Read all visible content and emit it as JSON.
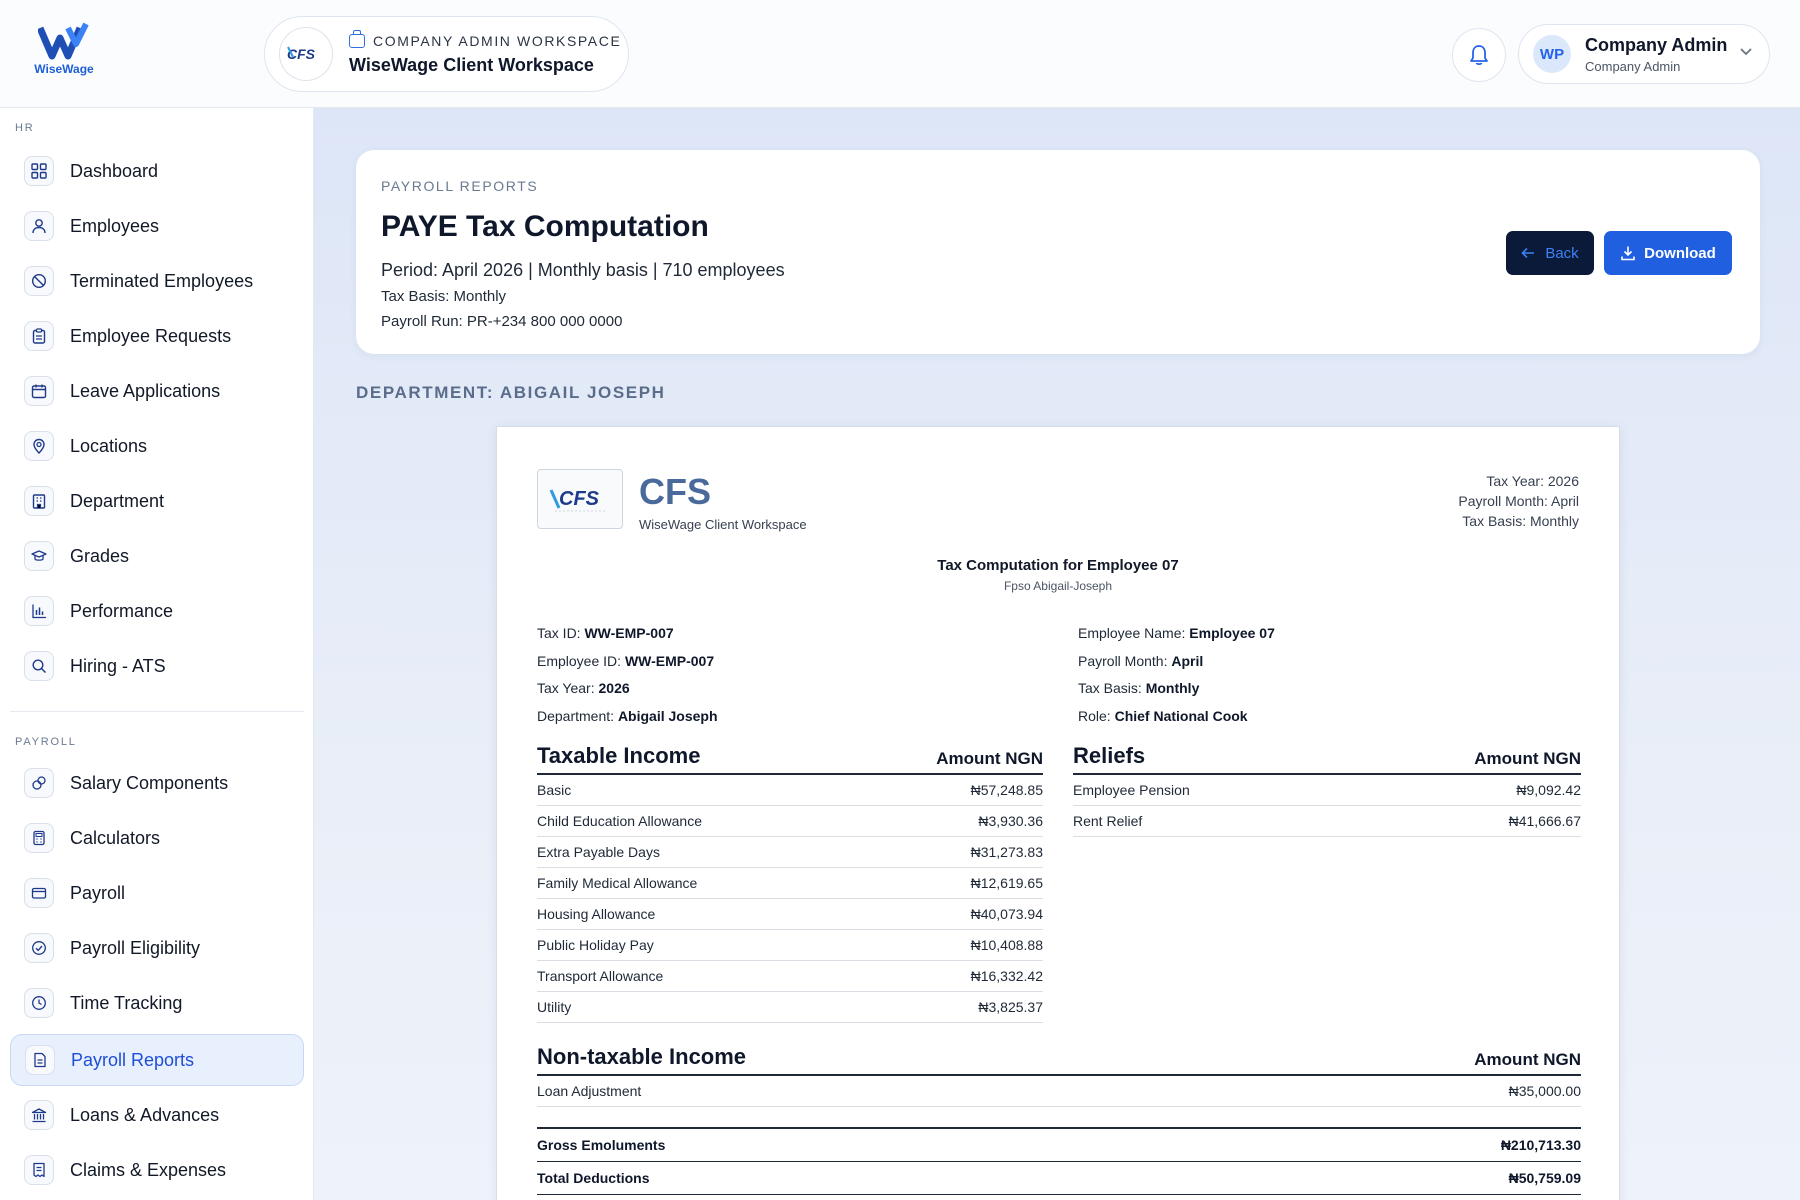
{
  "brand": {
    "name": "WiseWage"
  },
  "workspace": {
    "eyebrow": "COMPANY ADMIN WORKSPACE",
    "title": "WiseWage Client Workspace",
    "logo_text": "CFS"
  },
  "user": {
    "initials": "WP",
    "name": "Company Admin",
    "role": "Company Admin"
  },
  "sidebar": {
    "hr_label": "HR",
    "hr_items": [
      {
        "label": "Dashboard",
        "icon": "dashboard-icon"
      },
      {
        "label": "Employees",
        "icon": "user-icon"
      },
      {
        "label": "Terminated Employees",
        "icon": "user-slash-icon"
      },
      {
        "label": "Employee Requests",
        "icon": "clipboard-icon"
      },
      {
        "label": "Leave Applications",
        "icon": "calendar-icon"
      },
      {
        "label": "Locations",
        "icon": "location-pin-icon"
      },
      {
        "label": "Department",
        "icon": "building-icon"
      },
      {
        "label": "Grades",
        "icon": "graduation-cap-icon"
      },
      {
        "label": "Performance",
        "icon": "bar-chart-icon"
      },
      {
        "label": "Hiring - ATS",
        "icon": "search-icon"
      }
    ],
    "payroll_label": "PAYROLL",
    "payroll_items": [
      {
        "label": "Salary Components",
        "icon": "components-icon"
      },
      {
        "label": "Calculators",
        "icon": "calculator-icon"
      },
      {
        "label": "Payroll",
        "icon": "card-icon"
      },
      {
        "label": "Payroll Eligibility",
        "icon": "check-circle-icon"
      },
      {
        "label": "Time Tracking",
        "icon": "clock-icon"
      },
      {
        "label": "Payroll Reports",
        "icon": "report-icon",
        "active": true
      },
      {
        "label": "Loans & Advances",
        "icon": "bank-icon"
      },
      {
        "label": "Claims & Expenses",
        "icon": "receipt-icon"
      }
    ]
  },
  "report": {
    "eyebrow": "PAYROLL REPORTS",
    "title": "PAYE Tax Computation",
    "period": "Period: April 2026 | Monthly basis | 710 employees",
    "tax_basis": "Tax Basis: Monthly",
    "payroll_run": "Payroll Run: PR-+234 800 000 0000",
    "back_label": "Back",
    "download_label": "Download",
    "department_heading": "DEPARTMENT: ABIGAIL JOSEPH"
  },
  "doc": {
    "org": "CFS",
    "org_sub": "WiseWage Client Workspace",
    "meta": [
      "Tax Year: 2026",
      "Payroll Month: April",
      "Tax Basis: Monthly"
    ],
    "heading": "Tax Computation for Employee 07",
    "subheading": "Fpso Abigail-Joseph",
    "info_left": [
      {
        "k": "Tax ID: ",
        "v": "WW-EMP-007"
      },
      {
        "k": "Employee ID: ",
        "v": "WW-EMP-007"
      },
      {
        "k": "Tax Year: ",
        "v": "2026"
      },
      {
        "k": "Department: ",
        "v": "Abigail Joseph"
      }
    ],
    "info_right": [
      {
        "k": "Employee Name: ",
        "v": "Employee 07"
      },
      {
        "k": "Payroll Month: ",
        "v": "April"
      },
      {
        "k": "Tax Basis: ",
        "v": "Monthly"
      },
      {
        "k": "Role: ",
        "v": "Chief National Cook"
      }
    ],
    "taxable": {
      "title": "Taxable Income",
      "amount_header": "Amount NGN",
      "rows": [
        {
          "label": "Basic",
          "value": "₦57,248.85"
        },
        {
          "label": "Child Education Allowance",
          "value": "₦3,930.36"
        },
        {
          "label": "Extra Payable Days",
          "value": "₦31,273.83"
        },
        {
          "label": "Family Medical Allowance",
          "value": "₦12,619.65"
        },
        {
          "label": "Housing Allowance",
          "value": "₦40,073.94"
        },
        {
          "label": "Public Holiday Pay",
          "value": "₦10,408.88"
        },
        {
          "label": "Transport Allowance",
          "value": "₦16,332.42"
        },
        {
          "label": "Utility",
          "value": "₦3,825.37"
        }
      ]
    },
    "reliefs": {
      "title": "Reliefs",
      "amount_header": "Amount NGN",
      "rows": [
        {
          "label": "Employee Pension",
          "value": "₦9,092.42"
        },
        {
          "label": "Rent Relief",
          "value": "₦41,666.67"
        }
      ]
    },
    "nontaxable": {
      "title": "Non-taxable Income",
      "amount_header": "Amount NGN",
      "rows": [
        {
          "label": "Loan Adjustment",
          "value": "₦35,000.00"
        }
      ]
    },
    "totals": [
      {
        "label": "Gross Emoluments",
        "value": "₦210,713.30"
      },
      {
        "label": "Total Deductions",
        "value": "₦50,759.09"
      }
    ]
  }
}
